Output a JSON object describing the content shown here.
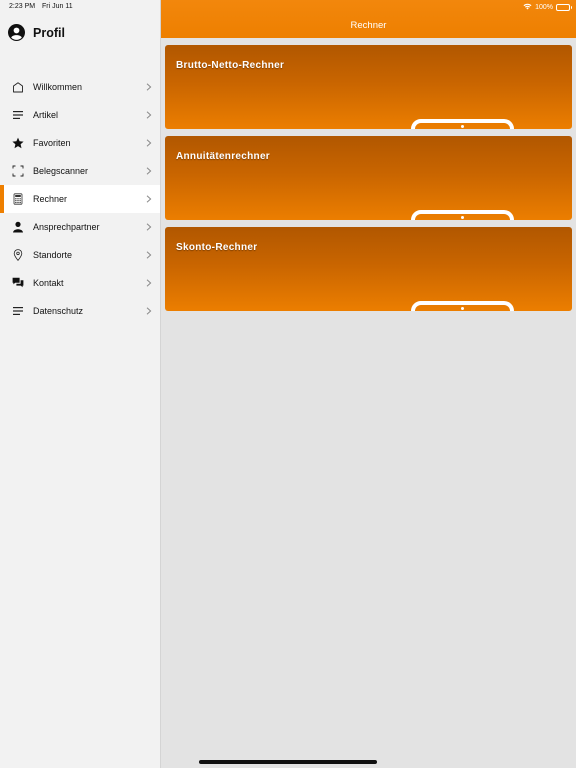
{
  "status_bar": {
    "time": "2:23 PM",
    "date": "Fri Jun 11",
    "battery": "100%",
    "icons": {
      "wifi": "wifi-icon",
      "battery": "battery-icon"
    }
  },
  "sidebar": {
    "profile_label": "Profil",
    "items": [
      {
        "label": "Willkommen",
        "icon": "home-icon",
        "active": false
      },
      {
        "label": "Artikel",
        "icon": "lines-icon",
        "active": false
      },
      {
        "label": "Favoriten",
        "icon": "star-icon",
        "active": false
      },
      {
        "label": "Belegscanner",
        "icon": "scan-icon",
        "active": false
      },
      {
        "label": "Rechner",
        "icon": "calculator-icon",
        "active": true
      },
      {
        "label": "Ansprechpartner",
        "icon": "person-icon",
        "active": false
      },
      {
        "label": "Standorte",
        "icon": "location-pin-icon",
        "active": false
      },
      {
        "label": "Kontakt",
        "icon": "chat-bubbles-icon",
        "active": false
      },
      {
        "label": "Datenschutz",
        "icon": "lines-icon",
        "active": false
      }
    ]
  },
  "header": {
    "title": "Rechner"
  },
  "cards": [
    {
      "title": "Brutto-Netto-Rechner"
    },
    {
      "title": "Annuitätenrechner"
    },
    {
      "title": "Skonto-Rechner"
    }
  ],
  "colors": {
    "accent": "#ee7f00",
    "card_top": "#b15700",
    "card_bottom": "#ec7e00",
    "sidebar_bg": "#f2f2f2",
    "content_bg": "#e3e3e3"
  }
}
